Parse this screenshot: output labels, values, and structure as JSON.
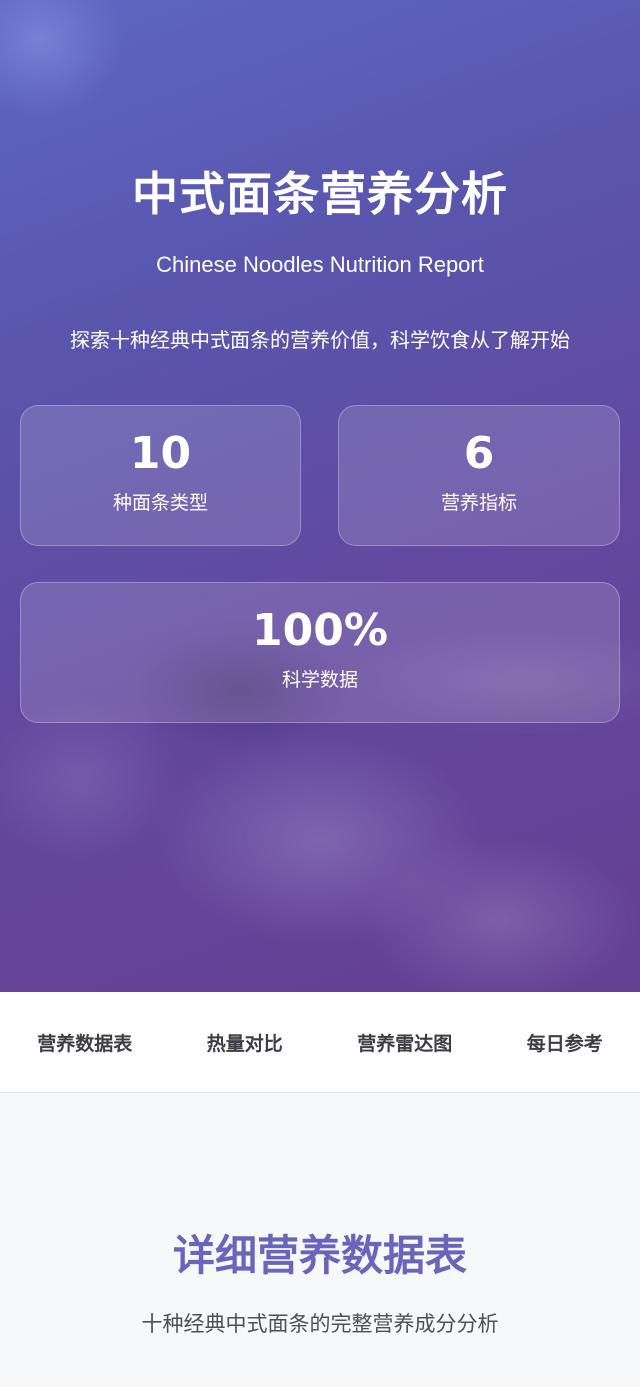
{
  "hero": {
    "title": "中式面条营养分析",
    "subtitle": "Chinese Noodles Nutrition Report",
    "description": "探索十种经典中式面条的营养价值，科学饮食从了解开始",
    "stats": [
      {
        "value": "10",
        "label": "种面条类型"
      },
      {
        "value": "6",
        "label": "营养指标"
      },
      {
        "value": "100%",
        "label": "科学数据"
      }
    ]
  },
  "nav": {
    "items": [
      {
        "label": "营养数据表"
      },
      {
        "label": "热量对比"
      },
      {
        "label": "营养雷达图"
      },
      {
        "label": "每日参考"
      }
    ]
  },
  "section": {
    "title": "详细营养数据表",
    "subtitle": "十种经典中式面条的完整营养成分分析"
  },
  "colors": {
    "hero_gradient_start": "#5d67c2",
    "hero_gradient_end": "#653f92",
    "section_title": "#6a64bd",
    "nav_background": "#ffffff",
    "page_background": "#f7f8fa"
  }
}
